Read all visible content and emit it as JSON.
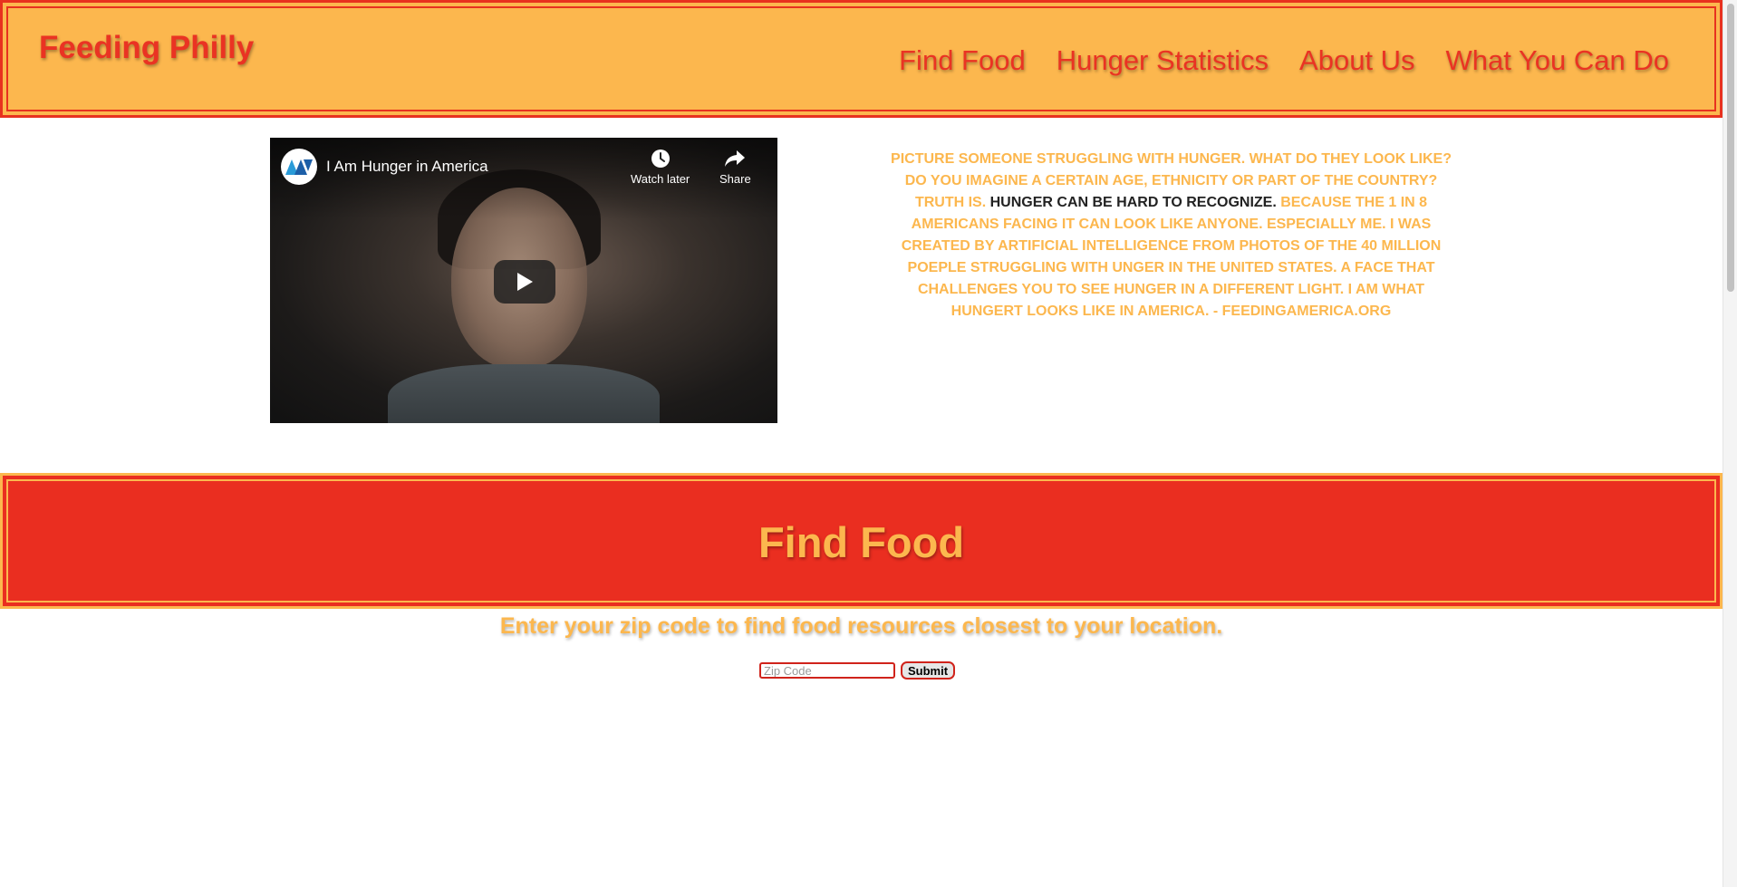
{
  "header": {
    "brand": "Feeding Philly",
    "nav": [
      "Find Food",
      "Hunger Statistics",
      "About Us",
      "What You Can Do"
    ]
  },
  "video": {
    "channel_logo_text": "MULTIVU",
    "title": "I Am Hunger in America",
    "watch_later_label": "Watch later",
    "share_label": "Share",
    "icons": [
      "clock-icon",
      "share-arrow-icon",
      "play-icon"
    ]
  },
  "quote": {
    "part1": "Picture someone struggling with hunger. What do they look like? Do you imagine a certain age, ethnicity or part of the country? Truth is. ",
    "highlight": "Hunger can be hard to recognize.",
    "part2": " Because the 1 in 8 Americans facing it can look like anyone. Especially me. I was created by artificial intelligence from photos of the 40 million poeple struggling with unger in the United States. A face that challenges you to see hunger in a different light. I am what hungert looks like in America. - FeedingAmerica.org"
  },
  "find_food": {
    "title": "Find Food",
    "subtitle": "Enter your zip code to find food resources closest to your location.",
    "zip_placeholder": "Zip Code",
    "zip_value": "",
    "submit_label": "Submit"
  },
  "colors": {
    "orange": "#fcb74e",
    "red": "#ea3323",
    "dark_text": "#222222"
  }
}
